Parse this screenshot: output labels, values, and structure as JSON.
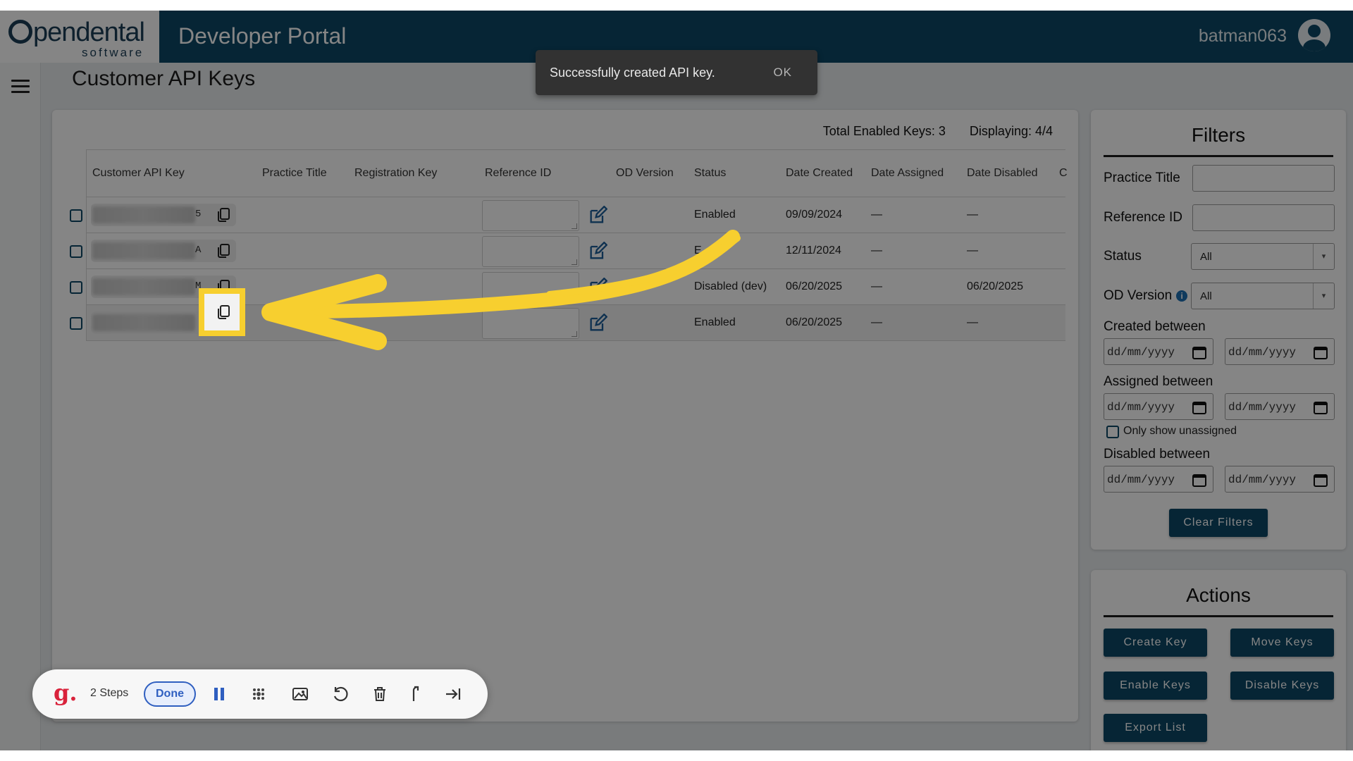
{
  "header": {
    "logo_text": "pendental",
    "logo_sub": "software",
    "portal_title": "Developer Portal",
    "username": "batman063"
  },
  "page": {
    "title": "Customer API Keys"
  },
  "notification": {
    "message": "Successfully created API key.",
    "action": "OK"
  },
  "summary": {
    "total_enabled": "Total Enabled Keys: 3",
    "displaying": "Displaying: 4/4"
  },
  "table": {
    "columns": [
      "Customer API Key",
      "Practice Title",
      "Registration Key",
      "Reference ID",
      "OD Version",
      "Status",
      "Date Created",
      "Date Assigned",
      "Date Disabled",
      "C"
    ],
    "rows": [
      {
        "key_tail": "5",
        "practice_title": "",
        "registration_key": "",
        "reference_id": "",
        "od_version": "",
        "status": "Enabled",
        "date_created": "09/09/2024",
        "date_assigned": "—",
        "date_disabled": "—"
      },
      {
        "key_tail": "A",
        "practice_title": "",
        "registration_key": "",
        "reference_id": "",
        "od_version": "",
        "status": "E",
        "date_created": "12/11/2024",
        "date_assigned": "—",
        "date_disabled": "—"
      },
      {
        "key_tail": "M",
        "practice_title": "",
        "registration_key": "",
        "reference_id": "",
        "od_version": "",
        "status": "Disabled (dev)",
        "date_created": "06/20/2025",
        "date_assigned": "—",
        "date_disabled": "06/20/2025"
      },
      {
        "key_tail": "",
        "practice_title": "",
        "registration_key": "",
        "reference_id": "",
        "od_version": "",
        "status": "Enabled",
        "date_created": "06/20/2025",
        "date_assigned": "—",
        "date_disabled": "—"
      }
    ]
  },
  "filters": {
    "title": "Filters",
    "practice_title_label": "Practice Title",
    "reference_id_label": "Reference ID",
    "status_label": "Status",
    "status_value": "All",
    "od_version_label": "OD Version",
    "od_version_value": "All",
    "created_label": "Created between",
    "assigned_label": "Assigned between",
    "only_unassigned_label": "Only show unassigned",
    "disabled_label": "Disabled between",
    "date_placeholder": "dd/mm/yyyy",
    "clear_button": "Clear Filters"
  },
  "actions": {
    "title": "Actions",
    "create": "Create Key",
    "move": "Move Keys",
    "enable": "Enable Keys",
    "disable": "Disable Keys",
    "export": "Export List"
  },
  "recorder": {
    "logo": "g.",
    "steps": "2 Steps",
    "done": "Done",
    "icons": [
      "pause-icon",
      "blur-icon",
      "image-icon",
      "undo-icon",
      "trash-icon",
      "share-icon",
      "skip-icon"
    ]
  },
  "colors": {
    "header_bg": "#0d4866",
    "primary_button": "#0d4866",
    "annotation_highlight": "#f7cf2f",
    "snackbar_bg": "#323232"
  }
}
